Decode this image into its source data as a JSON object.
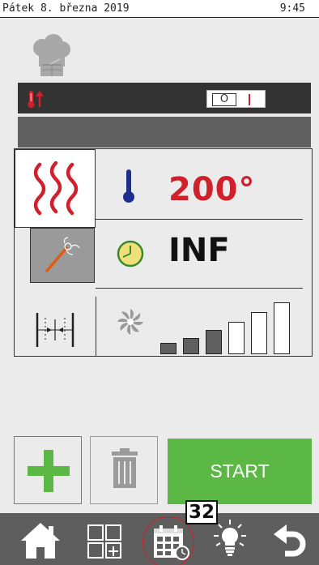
{
  "status_bar": {
    "date": "Pátek 8. března 2019",
    "time": "9:45"
  },
  "top_panel": {
    "heating_icon": "heat-up-icon",
    "toggle": {
      "off_label": "O",
      "state": "off"
    }
  },
  "settings": {
    "mode_icons": [
      "heat-waves-icon",
      "core-probe-icon",
      "damper-icon"
    ],
    "temperature": "200°",
    "time": "INF",
    "fan_speed_level": 3,
    "fan_speed_max": 6
  },
  "actions": {
    "add_icon": "plus-icon",
    "delete_icon": "trash-icon",
    "start_label": "START"
  },
  "nav": {
    "badge_count": "32",
    "items": [
      "home-icon",
      "programs-icon",
      "calendar-icon",
      "light-icon",
      "back-icon"
    ]
  },
  "colors": {
    "accent_red": "#d0202c",
    "start_green": "#5cb845",
    "clock_yellow": "#f0e07a"
  }
}
